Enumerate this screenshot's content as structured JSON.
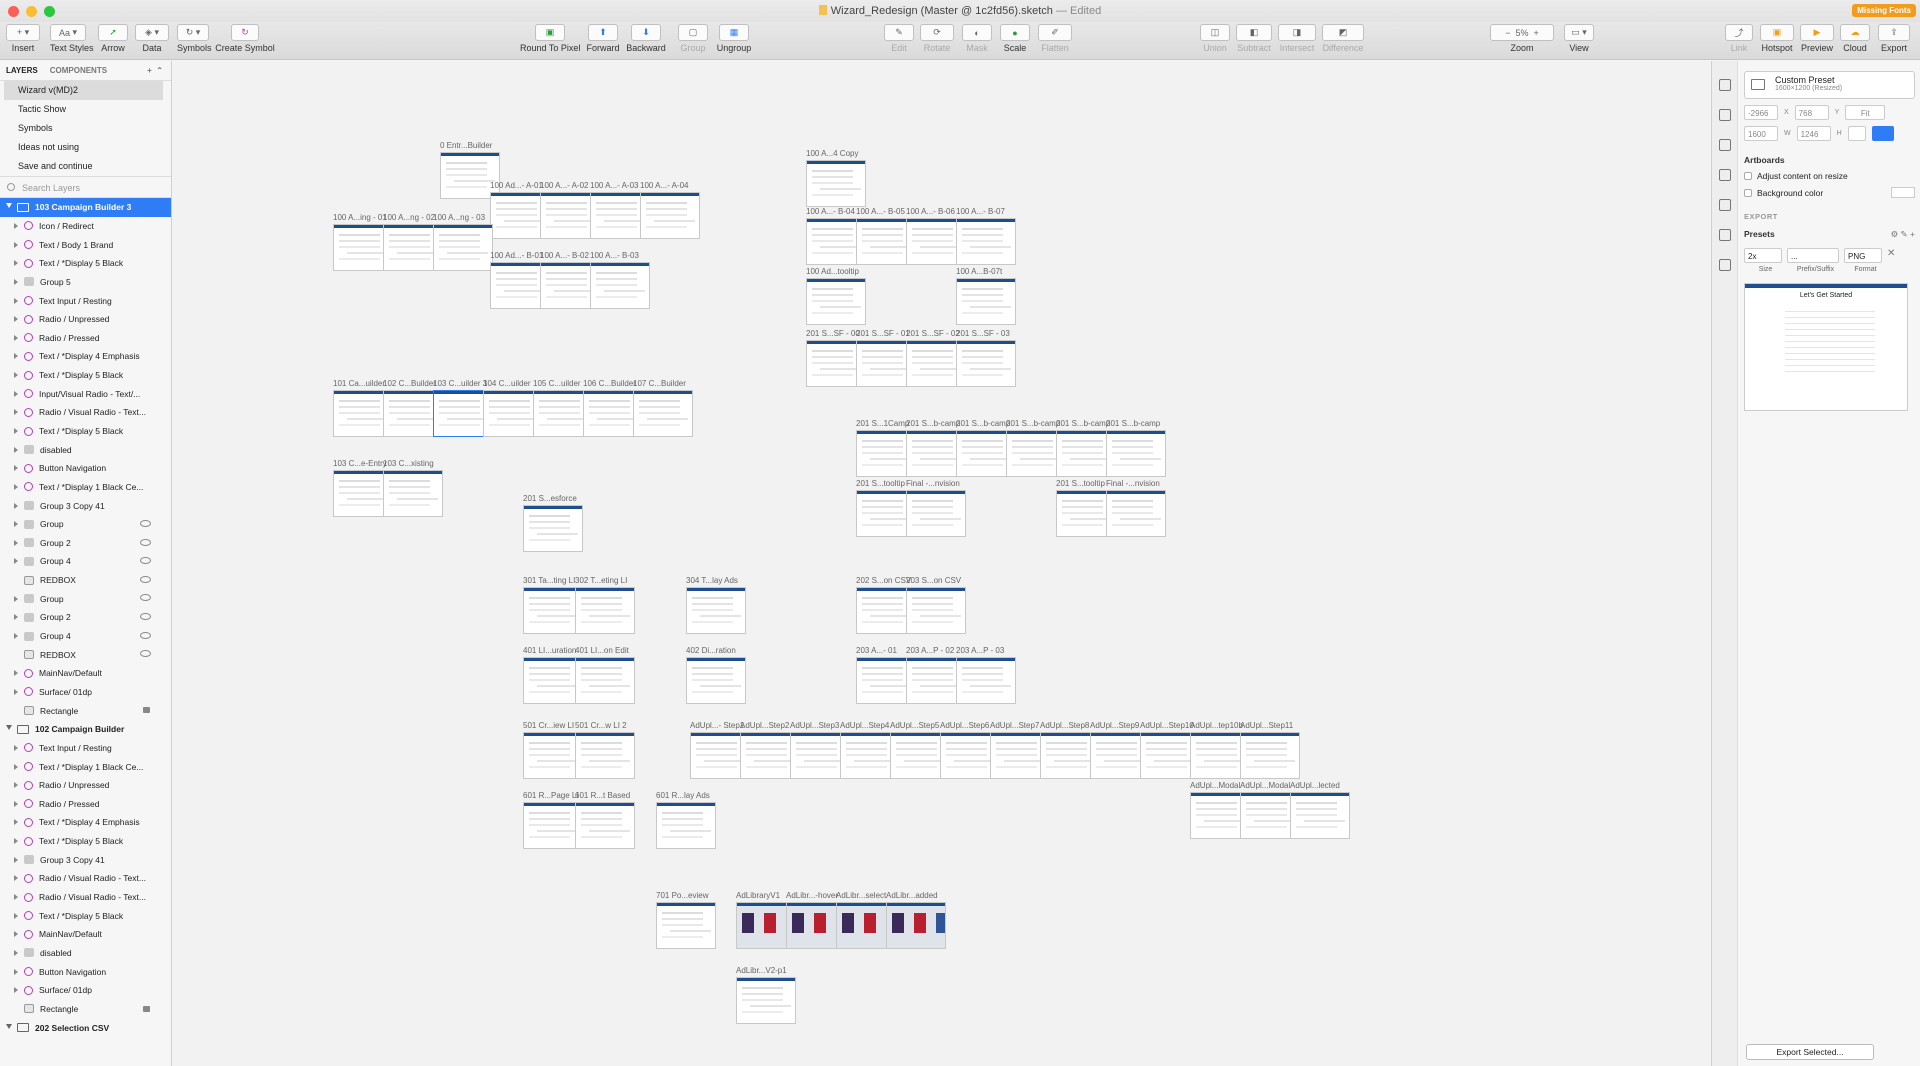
{
  "window": {
    "title": "Wizard_Redesign (Master @ 1c2fd56).sketch",
    "edited": "— Edited",
    "missing_fonts": "Missing Fonts"
  },
  "toolbar": {
    "insert": "Insert",
    "text_styles": "Text Styles",
    "arrow": "Arrow",
    "data": "Data",
    "symbols": "Symbols",
    "create_symbol": "Create Symbol",
    "round_to_pixel": "Round To Pixel",
    "forward": "Forward",
    "backward": "Backward",
    "group": "Group",
    "ungroup": "Ungroup",
    "edit": "Edit",
    "rotate": "Rotate",
    "mask": "Mask",
    "scale": "Scale",
    "flatten": "Flatten",
    "union": "Union",
    "subtract": "Subtract",
    "intersect": "Intersect",
    "difference": "Difference",
    "zoom": "Zoom",
    "zoom_value": "5%",
    "view": "View",
    "link": "Link",
    "hotspot": "Hotspot",
    "preview": "Preview",
    "cloud": "Cloud",
    "export": "Export",
    "text_btn": "Aa"
  },
  "left_panel": {
    "tab_layers": "LAYERS",
    "tab_components": "COMPONENTS",
    "pages": [
      "Wizard v(MD)2",
      "Tactic Show",
      "Symbols",
      "Ideas not using",
      "Save and continue"
    ],
    "search_placeholder": "Search Layers",
    "layers": [
      {
        "label": "103 Campaign Builder 3",
        "kind": "artboard",
        "selected": true
      },
      {
        "label": "Icon / Redirect",
        "kind": "symbol"
      },
      {
        "label": "Text / Body 1 Brand",
        "kind": "symbol"
      },
      {
        "label": "Text / *Display 5 Black",
        "kind": "symbol"
      },
      {
        "label": "Group 5",
        "kind": "folder"
      },
      {
        "label": "Text Input / Resting",
        "kind": "symbol"
      },
      {
        "label": "Radio / Unpressed",
        "kind": "symbol"
      },
      {
        "label": "Radio / Pressed",
        "kind": "symbol"
      },
      {
        "label": "Text / *Display 4 Emphasis",
        "kind": "symbol"
      },
      {
        "label": "Text / *Display 5 Black",
        "kind": "symbol"
      },
      {
        "label": "Input/Visual Radio - Text/...",
        "kind": "symbol"
      },
      {
        "label": "Radio / Visual Radio - Text...",
        "kind": "symbol"
      },
      {
        "label": "Text / *Display 5 Black",
        "kind": "symbol"
      },
      {
        "label": "disabled",
        "kind": "folder"
      },
      {
        "label": "Button Navigation",
        "kind": "symbol"
      },
      {
        "label": "Text / *Display 1 Black Ce...",
        "kind": "symbol"
      },
      {
        "label": "Group 3 Copy 41",
        "kind": "folder"
      },
      {
        "label": "Group",
        "kind": "folder",
        "hidden": true
      },
      {
        "label": "Group 2",
        "kind": "folder",
        "hidden": true
      },
      {
        "label": "Group 4",
        "kind": "folder",
        "hidden": true
      },
      {
        "label": "REDBOX",
        "kind": "rect",
        "hidden": true
      },
      {
        "label": "Group",
        "kind": "folder",
        "hidden": true
      },
      {
        "label": "Group 2",
        "kind": "folder",
        "hidden": true
      },
      {
        "label": "Group 4",
        "kind": "folder",
        "hidden": true
      },
      {
        "label": "REDBOX",
        "kind": "rect",
        "hidden": true
      },
      {
        "label": "MainNav/Default",
        "kind": "symbol"
      },
      {
        "label": "Surface/ 01dp",
        "kind": "symbol"
      },
      {
        "label": "Rectangle",
        "kind": "rect",
        "locked": true
      },
      {
        "label": "102 Campaign Builder",
        "kind": "artboard"
      },
      {
        "label": "Text Input / Resting",
        "kind": "symbol"
      },
      {
        "label": "Text / *Display 1 Black Ce...",
        "kind": "symbol"
      },
      {
        "label": "Radio / Unpressed",
        "kind": "symbol"
      },
      {
        "label": "Radio / Pressed",
        "kind": "symbol"
      },
      {
        "label": "Text / *Display 4 Emphasis",
        "kind": "symbol"
      },
      {
        "label": "Text / *Display 5 Black",
        "kind": "symbol"
      },
      {
        "label": "Group 3 Copy 41",
        "kind": "folder"
      },
      {
        "label": "Radio / Visual Radio - Text...",
        "kind": "symbol"
      },
      {
        "label": "Radio / Visual Radio - Text...",
        "kind": "symbol"
      },
      {
        "label": "Text / *Display 5 Black",
        "kind": "symbol"
      },
      {
        "label": "MainNav/Default",
        "kind": "symbol"
      },
      {
        "label": "disabled",
        "kind": "folder"
      },
      {
        "label": "Button Navigation",
        "kind": "symbol"
      },
      {
        "label": "Surface/ 01dp",
        "kind": "symbol"
      },
      {
        "label": "Rectangle",
        "kind": "rect",
        "locked": true
      },
      {
        "label": "202 Selection CSV",
        "kind": "artboard"
      }
    ]
  },
  "artboards": [
    "0 Entr...Builder",
    "100 Ad...- A-01",
    "100 A...- A-02",
    "100 A...- A-03",
    "100 A...- A-04",
    "100 A...ing - 01",
    "100 A...ng - 02",
    "100 A...ng - 03",
    "100 Ad...- B-01",
    "100 A...- B-02",
    "100 A...- B-03",
    "101 Ca...uilder",
    "102 C...Builder",
    "103 C...uilder 3",
    "104 C...uilder",
    "105 C...uilder",
    "106 C...Builder",
    "107 C...Builder",
    "103 C...e-Entry",
    "103 C...xisting",
    "201 S...esforce",
    "301 Ta...ting LI",
    "302 T...eting LI",
    "304 T...lay Ads",
    "401 LI...uration",
    "401 LI...on Edit",
    "402 Di...ration",
    "501 Cr...iew LI",
    "501 Cr...w LI 2",
    "601 R...Page LI",
    "601 R...t Based",
    "601 R...lay Ads",
    "701 Po...eview",
    "100 A...4 Copy",
    "100 A...- B-04",
    "100 A...- B-05",
    "100 A...- B-06",
    "100 A...- B-07",
    "100 Ad...tooltip",
    "100 A...B-07t",
    "201 S...SF - 00",
    "201 S...SF - 01",
    "201 S...SF - 02",
    "201 S...SF - 03",
    "201 S...1Camp",
    "201 S...b-camp",
    "201 S...b-camp",
    "201 S...b-camp",
    "201 S...b-camp",
    "201 S...b-camp",
    "201 S...tooltip",
    "Final -...nvision",
    "201 S...tooltip",
    "Final -...nvision",
    "202 S...on CSV",
    "203 S...on CSV",
    "203 A...- 01",
    "203 A...P - 02",
    "203 A...P - 03",
    "AdUpl...- Step1",
    "AdUpl...Step2",
    "AdUpl...Step3",
    "AdUpl...Step4",
    "AdUpl...Step5",
    "AdUpl...Step6",
    "AdUpl...Step7",
    "AdUpl...Step8",
    "AdUpl...Step9",
    "AdUpl...Step10",
    "AdUpl...tep10b",
    "AdUpl...Step11",
    "AdUpl...Modal",
    "AdUpl...Modal",
    "AdUpl...lected",
    "AdLibraryV1",
    "AdLibr...-hover",
    "AdLibr...select",
    "AdLibr...added",
    "AdLibr...V2-p1"
  ],
  "inspector": {
    "preset_name": "Custom Preset",
    "preset_size": "1600×1200 (Resized)",
    "x": "-2966",
    "x_label": "X",
    "y": "768",
    "y_label": "Y",
    "fit": "Fit",
    "w": "1600",
    "w_label": "W",
    "h": "1246",
    "h_label": "H",
    "artboards_title": "Artboards",
    "adjust_content": "Adjust content on resize",
    "background_color": "Background color",
    "export_title": "EXPORT",
    "presets": "Presets",
    "export_scale": "2x",
    "export_suffix": "...",
    "export_format": "PNG",
    "size_label": "Size",
    "prefix_label": "Prefix/Suffix",
    "format_label": "Format",
    "thumb_title": "Let's Get Started",
    "export_selected": "Export Selected..."
  },
  "colors": {
    "selection": "#2e7cf6",
    "artboard_header": "#1d4f8e",
    "missing_fonts": "#f39c1b"
  }
}
